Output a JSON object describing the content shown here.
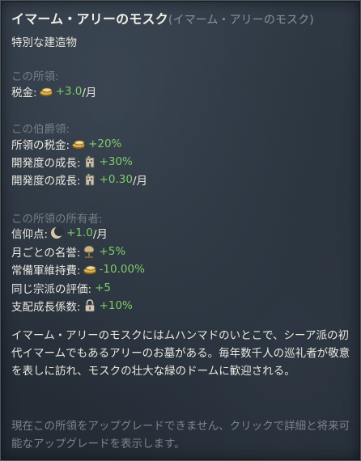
{
  "header": {
    "title": "イマーム・アリーのモスク",
    "title_alt": "(イマーム・アリーのモスク)",
    "subtitle": "特別な建造物"
  },
  "sections": {
    "this_holding": {
      "heading": "この所領:",
      "tax_label": "税金:",
      "tax_icon": "gold-coins-icon",
      "tax_value": "+3.0",
      "tax_unit": "/月"
    },
    "county": {
      "heading": "この伯爵領:",
      "holding_tax_label": "所領の税金:",
      "holding_tax_value": "+20%",
      "dev_growth_label": "開発度の成長:",
      "dev_growth_value": "+30%",
      "dev_growth2_label": "開発度の成長:",
      "dev_growth2_value": "+0.30",
      "dev_growth2_unit": "/月"
    },
    "owner": {
      "heading": "この所領の所有者:",
      "piety_label": "信仰点:",
      "piety_value": "+1.0",
      "piety_unit": "/月",
      "prestige_label": "月ごとの名誉:",
      "prestige_value": "+5%",
      "upkeep_label": "常備軍維持費:",
      "upkeep_value": "-10.00%",
      "faith_opinion_label": "同じ宗派の評価:",
      "faith_opinion_value": "+5",
      "control_label": "支配成長係数:",
      "control_value": "+10%"
    }
  },
  "description": "イマーム・アリーのモスクにはムハンマドのいとこで、シーア派の初代イマームでもあるアリーのお墓がある。毎年数千人の巡礼者が敬意を表しに訪れ、モスクの壮大な緑のドームに歓迎される。",
  "hint": "現在この所領をアップグレードできません、クリックで詳細と将来可能なアップグレードを表示します。",
  "colors": {
    "positive": "#7fcb6a",
    "heading": "#767e87",
    "text": "#ebe8df"
  }
}
